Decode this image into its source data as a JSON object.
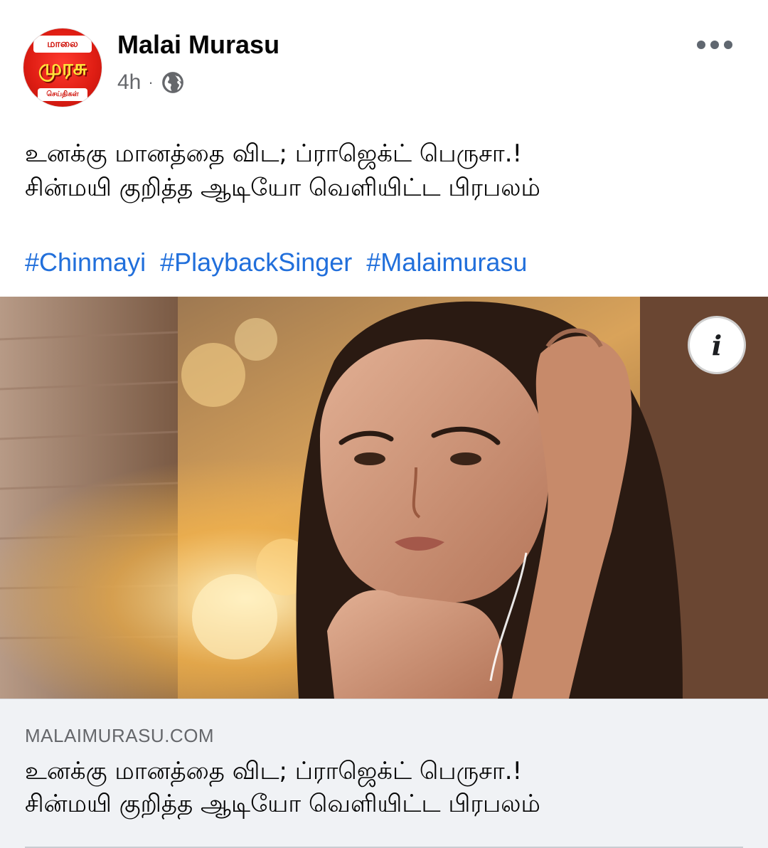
{
  "post": {
    "page_name": "Malai Murasu",
    "timestamp": "4h",
    "separator": "·",
    "privacy_icon": "globe-icon",
    "more_icon": "more-horizontal-icon",
    "avatar": {
      "top_text": "மாலை",
      "middle_text": "முரசு",
      "bottom_text": "செய்திகள்"
    },
    "text_lines": [
      "உனக்கு மானத்தை விட; ப்ராஜெக்ட் பெருசா.!",
      "சின்மயி குறித்த ஆடியோ வெளியிட்ட பிரபலம்"
    ],
    "hashtags": [
      "#Chinmayi",
      "#PlaybackSinger",
      "#Malaimurasu"
    ]
  },
  "link_preview": {
    "info_icon": "info-icon",
    "info_glyph": "i",
    "domain": "MALAIMURASU.COM",
    "title_lines": [
      "உனக்கு மானத்தை விட; ப்ராஜெக்ட் பெருசா.!",
      "சின்மயி குறித்த ஆடியோ வெளியிட்ட பிரபலம்"
    ]
  },
  "colors": {
    "hashtag": "#216fdb",
    "secondary_text": "#65676b",
    "link_footer_bg": "#f0f2f5",
    "brand_red": "#e01e14"
  }
}
